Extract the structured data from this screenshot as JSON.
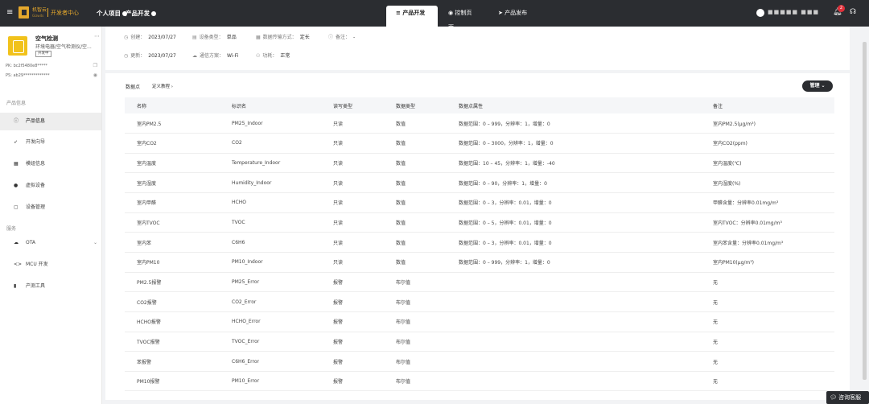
{
  "topbar": {
    "menu_icon": "hamburger-icon",
    "brand": "机智云",
    "brand_sub": "Gizwits",
    "dev_center": "开发者中心",
    "nav_personal": "个人项目",
    "nav_product_dev": "产品开发",
    "tabs": [
      {
        "label": "产品开发",
        "icon": "≡",
        "active": true
      },
      {
        "label": "控制页面",
        "icon": "◉",
        "active": false
      },
      {
        "label": "产品发布",
        "icon": "➤",
        "active": false
      }
    ],
    "user": "■■■■■ ■■■",
    "notification_count": "2"
  },
  "sidebar": {
    "product_name": "空气检测",
    "product_category": "环境电器/空气检测仪/空...",
    "product_tag": "开发中",
    "pk_label": "PK:",
    "pk_value": "bc2f5480e8*****",
    "ps_label": "PS:",
    "ps_value": "ab29*************",
    "section_product": "产品信息",
    "section_service": "服务",
    "items": [
      {
        "label": "产品信息",
        "icon": "ⓘ"
      },
      {
        "label": "开发向导",
        "icon": "➶"
      },
      {
        "label": "模组信息",
        "icon": "▦"
      },
      {
        "label": "虚拟设备",
        "icon": "●"
      },
      {
        "label": "设备管理",
        "icon": "▢"
      }
    ],
    "service_items": [
      {
        "label": "OTA",
        "icon": "☁"
      },
      {
        "label": "MCU 开发",
        "icon": "<>"
      },
      {
        "label": "产测工具",
        "icon": "▮"
      }
    ]
  },
  "info": {
    "created_label": "创建：",
    "created": "2023/07/27",
    "device_type_label": "设备类型：",
    "device_type": "单品",
    "transfer_label": "数据传输方式：",
    "transfer": "定长",
    "remark_label": "备注：",
    "remark": "-",
    "updated_label": "更新：",
    "updated": "2023/07/27",
    "comm_label": "通信方案：",
    "comm": "Wi-Fi",
    "power_label": "功耗：",
    "power": "正常"
  },
  "main": {
    "crumb": "数据点",
    "tutorial": "定义教程 ›",
    "manage": "管理 ⌄",
    "columns": [
      "名称",
      "标识名",
      "读写类型",
      "数据类型",
      "数据点属性",
      "备注"
    ],
    "rows": [
      [
        "室内PM2.5",
        "PM25_Indoor",
        "只读",
        "数值",
        "数据范围：0 – 999，分辨率：1，增量：0",
        "室内PM2.5(μg/m³)"
      ],
      [
        "室内CO2",
        "CO2",
        "只读",
        "数值",
        "数据范围：0 – 3000，分辨率：1，增量：0",
        "室内CO2(ppm)"
      ],
      [
        "室内温度",
        "Temperature_Indoor",
        "只读",
        "数值",
        "数据范围：10 – 45，分辨率：1，增量：-40",
        "室内温度(℃)"
      ],
      [
        "室内湿度",
        "Humidity_Indoor",
        "只读",
        "数值",
        "数据范围：0 – 90，分辨率：1，增量：0",
        "室内湿度(%)"
      ],
      [
        "室内甲醛",
        "HCHO",
        "只读",
        "数值",
        "数据范围：0 – 3，分辨率：0.01，增量：0",
        "甲醛含量：分辨率0.01mg/m³"
      ],
      [
        "室内TVOC",
        "TVOC",
        "只读",
        "数值",
        "数据范围：0 – 5，分辨率：0.01，增量：0",
        "室内TVOC：分辨率0.01mg/m³"
      ],
      [
        "室内苯",
        "C6H6",
        "只读",
        "数值",
        "数据范围：0 – 3，分辨率：0.01，增量：0",
        "室内苯含量：分辨率0.01mg/m³"
      ],
      [
        "室内PM10",
        "PM10_Indoor",
        "只读",
        "数值",
        "数据范围：0 – 999，分辨率：1，增量：0",
        "室内PM10(μg/m³)"
      ],
      [
        "PM2.5报警",
        "PM25_Error",
        "报警",
        "布尔值",
        "",
        "无"
      ],
      [
        "CO2报警",
        "CO2_Error",
        "报警",
        "布尔值",
        "",
        "无"
      ],
      [
        "HCHO报警",
        "HCHO_Error",
        "报警",
        "布尔值",
        "",
        "无"
      ],
      [
        "TVOC报警",
        "TVOC_Error",
        "报警",
        "布尔值",
        "",
        "无"
      ],
      [
        "苯报警",
        "C6H6_Error",
        "报警",
        "布尔值",
        "",
        "无"
      ],
      [
        "PM10报警",
        "PM10_Error",
        "报警",
        "布尔值",
        "",
        "无"
      ]
    ]
  },
  "chat": "咨询客服"
}
